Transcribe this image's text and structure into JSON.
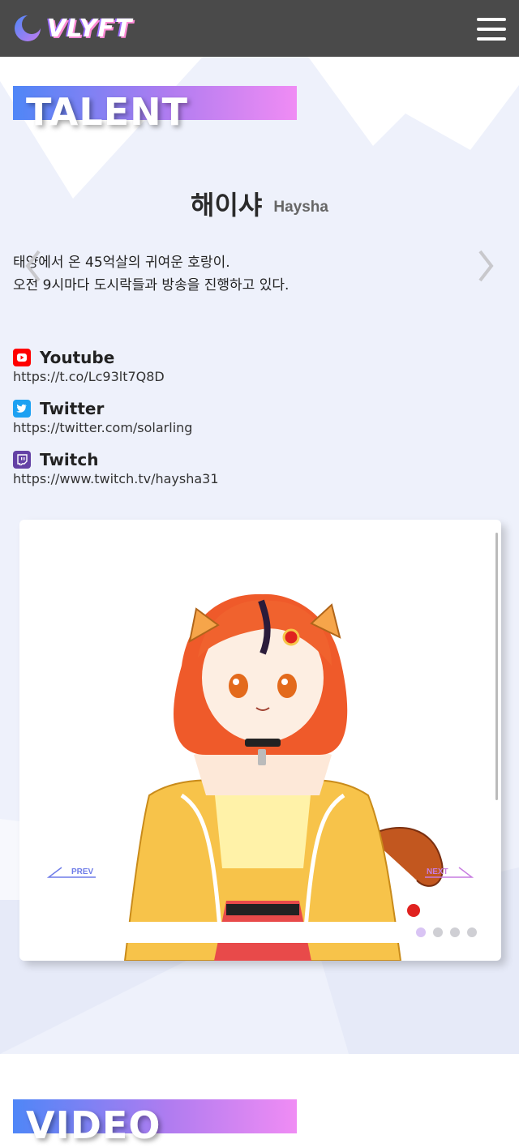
{
  "header": {
    "logo_text": "VLYFT"
  },
  "talent_section": {
    "title": "TALENT",
    "name_kr": "해이샤",
    "name_en": "Haysha",
    "description": [
      "태양에서 온 45억살의 귀여운 호랑이.",
      "오전 9시마다 도시락들과 방송을 진행하고 있다."
    ],
    "links": [
      {
        "title": "Youtube",
        "url": "https://t.co/Lc93lt7Q8D",
        "icon": "youtube-icon",
        "color": "#ff0000"
      },
      {
        "title": "Twitter",
        "url": "https://twitter.com/solarling",
        "icon": "twitter-icon",
        "color": "#1da1f2"
      },
      {
        "title": "Twitch",
        "url": "https://www.twitch.tv/haysha31",
        "icon": "twitch-icon",
        "color": "#6441a5"
      }
    ],
    "carousel": {
      "prev_label": "PREV",
      "next_label": "NEXT",
      "slide_count": 4,
      "active_index": 0
    }
  },
  "video_section": {
    "title": "VIDEO"
  },
  "colors": {
    "header_bg": "#4a4a4a",
    "title_gradient_start": "#4f86f7",
    "title_gradient_end": "#f08cf4",
    "bg_shapes": "#eef1fb"
  }
}
